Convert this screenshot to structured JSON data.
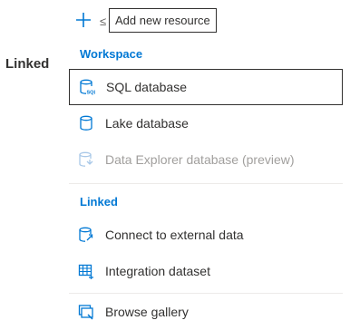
{
  "side": {
    "linked_label": "Linked"
  },
  "toolbar": {
    "plus_icon": "plus-icon",
    "behind_text": "≤",
    "tooltip": "Add new resource"
  },
  "menu": {
    "sections": [
      {
        "header": "Workspace",
        "items": [
          {
            "label": "SQL database",
            "icon": "sql-database-icon",
            "focused": true,
            "disabled": false
          },
          {
            "label": "Lake database",
            "icon": "lake-database-icon",
            "focused": false,
            "disabled": false
          },
          {
            "label": "Data Explorer database (preview)",
            "icon": "data-explorer-database-icon",
            "focused": false,
            "disabled": true
          }
        ]
      },
      {
        "header": "Linked",
        "items": [
          {
            "label": "Connect to external data",
            "icon": "connect-external-data-icon",
            "focused": false,
            "disabled": false
          },
          {
            "label": "Integration dataset",
            "icon": "integration-dataset-icon",
            "focused": false,
            "disabled": false
          }
        ]
      }
    ],
    "footer_item": {
      "label": "Browse gallery",
      "icon": "browse-gallery-icon"
    }
  },
  "colors": {
    "accent": "#0078d4",
    "text": "#323130",
    "disabled": "#a19f9d"
  }
}
